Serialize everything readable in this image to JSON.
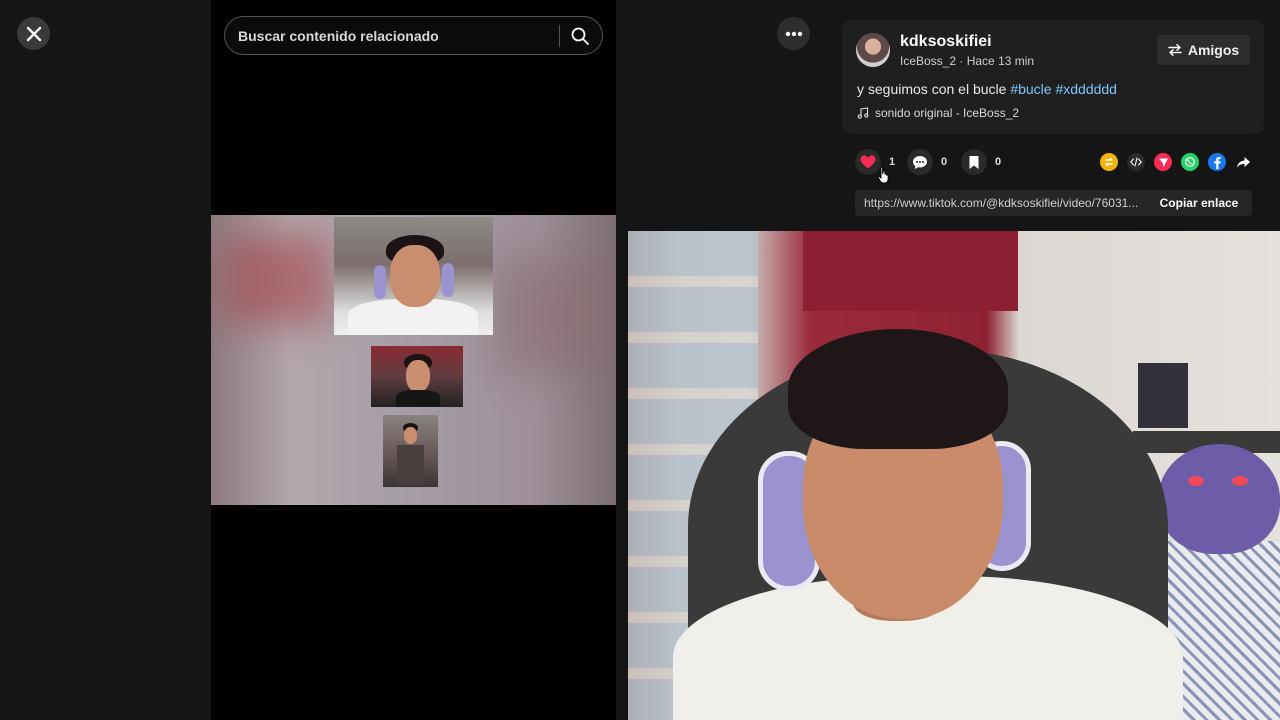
{
  "search": {
    "placeholder": "Buscar contenido relacionado"
  },
  "post": {
    "username": "kdksoskifiei",
    "handle": "IceBoss_2",
    "separator": " · ",
    "time": "Hace 13 min",
    "follow_label": "Amigos",
    "caption_text": "y seguimos con el bucle ",
    "hashtags": [
      "#bucle",
      "#xdddddd"
    ],
    "sound": "sonido original - IceBoss_2"
  },
  "stats": {
    "likes": "1",
    "comments": "0",
    "saves": "0"
  },
  "share_targets": [
    "repost-icon",
    "embed-icon",
    "send-icon",
    "whatsapp-icon",
    "facebook-icon",
    "share-icon"
  ],
  "link": {
    "url": "https://www.tiktok.com/@kdksoskifiei/video/76031...",
    "copy_label": "Copiar enlace"
  },
  "colors": {
    "like_active": "#fe2c55",
    "hashtag": "#7ec6ff",
    "repost": "#f5b400",
    "send": "#fe2c55",
    "whatsapp": "#25d366",
    "facebook": "#1877f2"
  }
}
